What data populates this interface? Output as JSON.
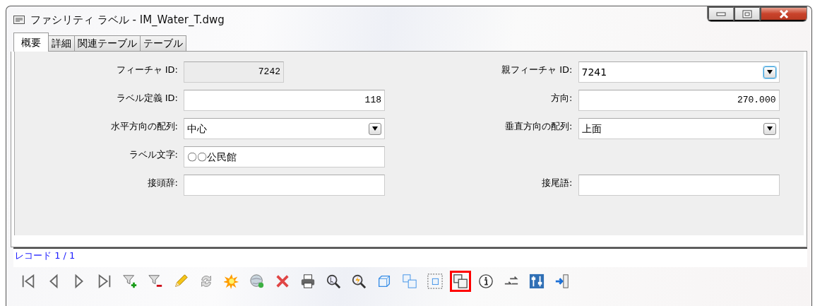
{
  "window": {
    "title": "ファシリティ ラベル - IM_Water_T.dwg"
  },
  "tabs": [
    {
      "label": "概要",
      "selected": true
    },
    {
      "label": "詳細",
      "selected": false
    },
    {
      "label": "関連テーブル",
      "selected": false
    },
    {
      "label": "テーブル",
      "selected": false
    }
  ],
  "form_rows": [
    {
      "left": {
        "label": "フィーチャ ID:",
        "value": "7242",
        "kind": "number",
        "disabled": true
      },
      "right": {
        "label": "親フィーチャ ID:",
        "value": "7241",
        "kind": "dropdown",
        "focused": true
      }
    },
    {
      "left": {
        "label": "ラベル定義 ID:",
        "value": "118",
        "kind": "number"
      },
      "right": {
        "label": "方向:",
        "value": "270.000",
        "kind": "number"
      }
    },
    {
      "left": {
        "label": "水平方向の配列:",
        "value": "中心",
        "kind": "dropdown",
        "focused": false
      },
      "right": {
        "label": "垂直方向の配列:",
        "value": "上面",
        "kind": "dropdown",
        "focused": false
      }
    },
    {
      "left": {
        "label": "ラベル文字:",
        "value": "〇〇公民館",
        "kind": "text"
      }
    },
    {
      "left": {
        "label": "接頭辞:",
        "kind": "text"
      },
      "right": {
        "label": "接尾語:",
        "kind": "text"
      }
    }
  ],
  "record_status": "レコード 1 / 1",
  "toolbar": [
    {
      "kind": "first",
      "selected": false
    },
    {
      "kind": "prev",
      "selected": false
    },
    {
      "kind": "next",
      "selected": false
    },
    {
      "kind": "last",
      "selected": false
    },
    {
      "kind": "filter-add",
      "selected": false
    },
    {
      "kind": "filter-remove",
      "selected": false
    },
    {
      "kind": "pencil",
      "selected": false
    },
    {
      "kind": "refresh",
      "selected": false
    },
    {
      "kind": "burst",
      "selected": false
    },
    {
      "kind": "globe",
      "selected": false
    },
    {
      "kind": "delete",
      "selected": false
    },
    {
      "kind": "print",
      "selected": false
    },
    {
      "kind": "zoom-select",
      "selected": false
    },
    {
      "kind": "zoom-flash",
      "selected": false
    },
    {
      "kind": "cube",
      "selected": false
    },
    {
      "kind": "cubes",
      "selected": false
    },
    {
      "kind": "dotted-cube",
      "selected": false
    },
    {
      "kind": "stacked-squares",
      "selected": true
    },
    {
      "kind": "info",
      "selected": false
    },
    {
      "kind": "arrows",
      "selected": false
    },
    {
      "kind": "sliders",
      "selected": false
    },
    {
      "kind": "exit",
      "selected": false
    }
  ]
}
